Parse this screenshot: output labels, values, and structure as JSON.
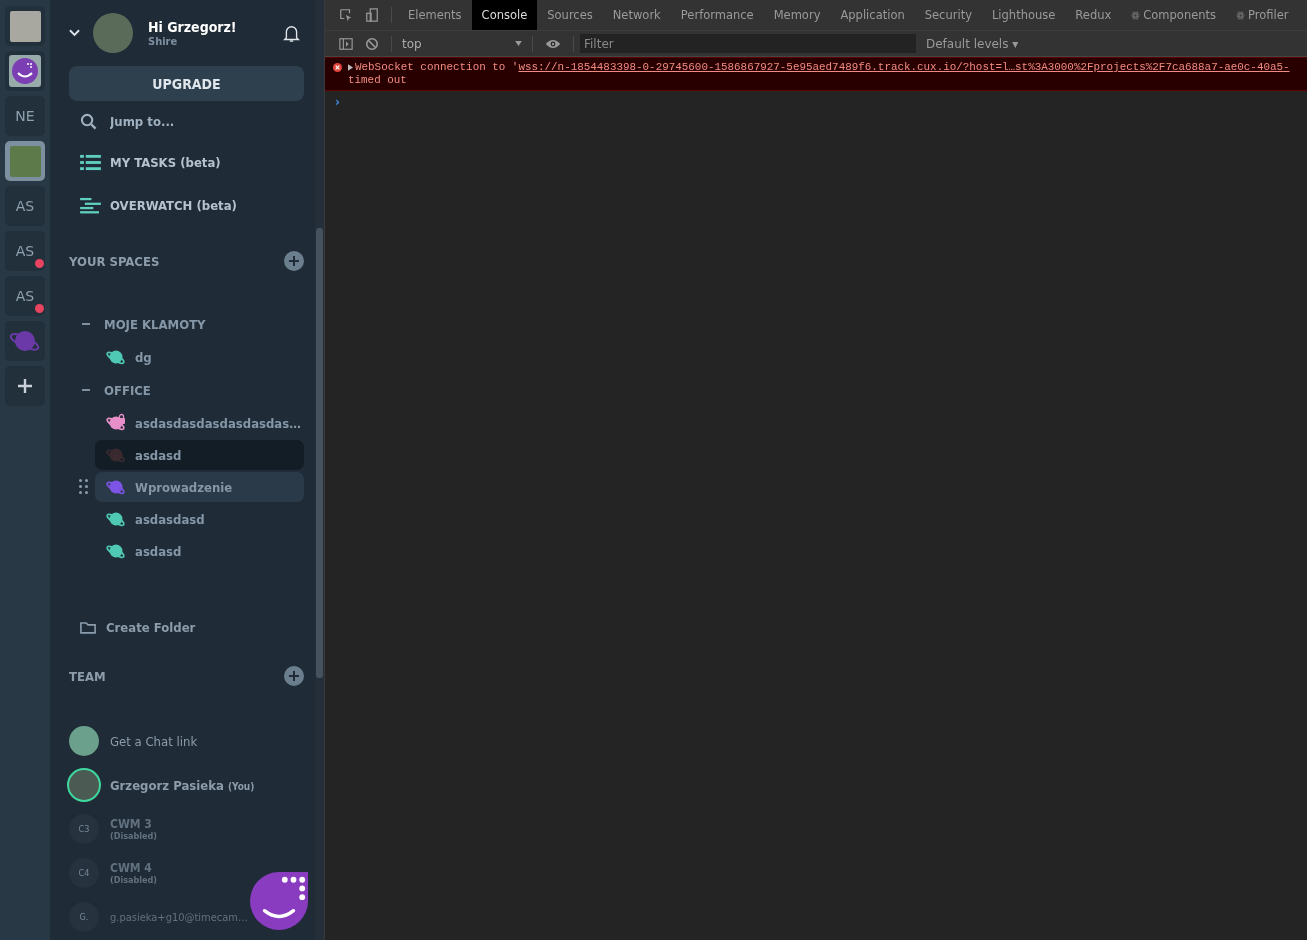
{
  "rail": [
    {
      "kind": "photo",
      "selected": false
    },
    {
      "kind": "logo",
      "selected": false
    },
    {
      "kind": "text",
      "label": "NE",
      "selected": false
    },
    {
      "kind": "photo",
      "selected": true
    },
    {
      "kind": "text",
      "label": "AS",
      "selected": false
    },
    {
      "kind": "text",
      "label": "AS",
      "selected": false,
      "notification": true
    },
    {
      "kind": "text",
      "label": "AS",
      "selected": false,
      "notification": true
    },
    {
      "kind": "planet",
      "selected": false
    },
    {
      "kind": "add",
      "selected": false
    }
  ],
  "user": {
    "greeting": "Hi Grzegorz!",
    "workspace": "Shire"
  },
  "upgrade": "UPGRADE",
  "search": {
    "placeholder": "Jump to..."
  },
  "nav": [
    {
      "kind": "tasks",
      "label": "MY TASKS (beta)"
    },
    {
      "kind": "overwatch",
      "label": "OVERWATCH (beta)"
    }
  ],
  "spaces": {
    "title": "YOUR SPACES",
    "folders": [
      {
        "name": "MOJE KLAMOTY",
        "expanded": true,
        "children": [
          {
            "name": "dg",
            "color": "#4fc9b4",
            "selected": false,
            "hovered": false
          }
        ]
      },
      {
        "name": "OFFICE",
        "expanded": true,
        "children": [
          {
            "name": "asdasdasdasdasdasdas…",
            "color": "#e88fc9",
            "locked": true,
            "selected": false,
            "hovered": false
          },
          {
            "name": "asdasd",
            "color": "#3a2a30",
            "selected": true,
            "hovered": false
          },
          {
            "name": "Wprowadzenie",
            "color": "#7c55e6",
            "selected": false,
            "hovered": true
          },
          {
            "name": "asdasdasd",
            "color": "#4fc9b4",
            "selected": false,
            "hovered": false
          },
          {
            "name": "asdasd",
            "color": "#4fc9b4",
            "selected": false,
            "hovered": false
          }
        ]
      }
    ]
  },
  "create_folder": "Create Folder",
  "team": {
    "title": "TEAM",
    "members": [
      {
        "kind": "link",
        "name": "Get a Chat link"
      },
      {
        "kind": "user",
        "name": "Grzegorz Pasieka",
        "note": "(You)"
      },
      {
        "kind": "disabled",
        "name": "CWM 3",
        "note": "(Disabled)",
        "initials": "C3"
      },
      {
        "kind": "disabled",
        "name": "CWM 4",
        "note": "(Disabled)",
        "initials": "C4"
      },
      {
        "kind": "disabled",
        "name": "g.pasieka+g10@timecam…",
        "initials": "G."
      }
    ]
  },
  "devtools": {
    "tabs": [
      {
        "label": "Elements",
        "selected": false,
        "react": false
      },
      {
        "label": "Console",
        "selected": true,
        "react": false
      },
      {
        "label": "Sources",
        "selected": false,
        "react": false
      },
      {
        "label": "Network",
        "selected": false,
        "react": false
      },
      {
        "label": "Performance",
        "selected": false,
        "react": false
      },
      {
        "label": "Memory",
        "selected": false,
        "react": false
      },
      {
        "label": "Application",
        "selected": false,
        "react": false
      },
      {
        "label": "Security",
        "selected": false,
        "react": false
      },
      {
        "label": "Lighthouse",
        "selected": false,
        "react": false
      },
      {
        "label": "Redux",
        "selected": false,
        "react": false
      },
      {
        "label": "Components",
        "selected": false,
        "react": true
      },
      {
        "label": "Profiler",
        "selected": false,
        "react": true
      }
    ],
    "context": "top",
    "filter": {
      "placeholder": "Filter"
    },
    "levels": "Default levels ▾",
    "messages": [
      {
        "kind": "error",
        "prefix": "WebSocket connection to '",
        "url": "wss://n-1854483398-0-29745600-1586867927-5e95aed7489f6.track.cux.io/?host=l…st%3A3000%2Fprojects%2F7ca688a7-ae0c-40a5-",
        "suffix": "timed out"
      }
    ],
    "prompt": "›"
  }
}
